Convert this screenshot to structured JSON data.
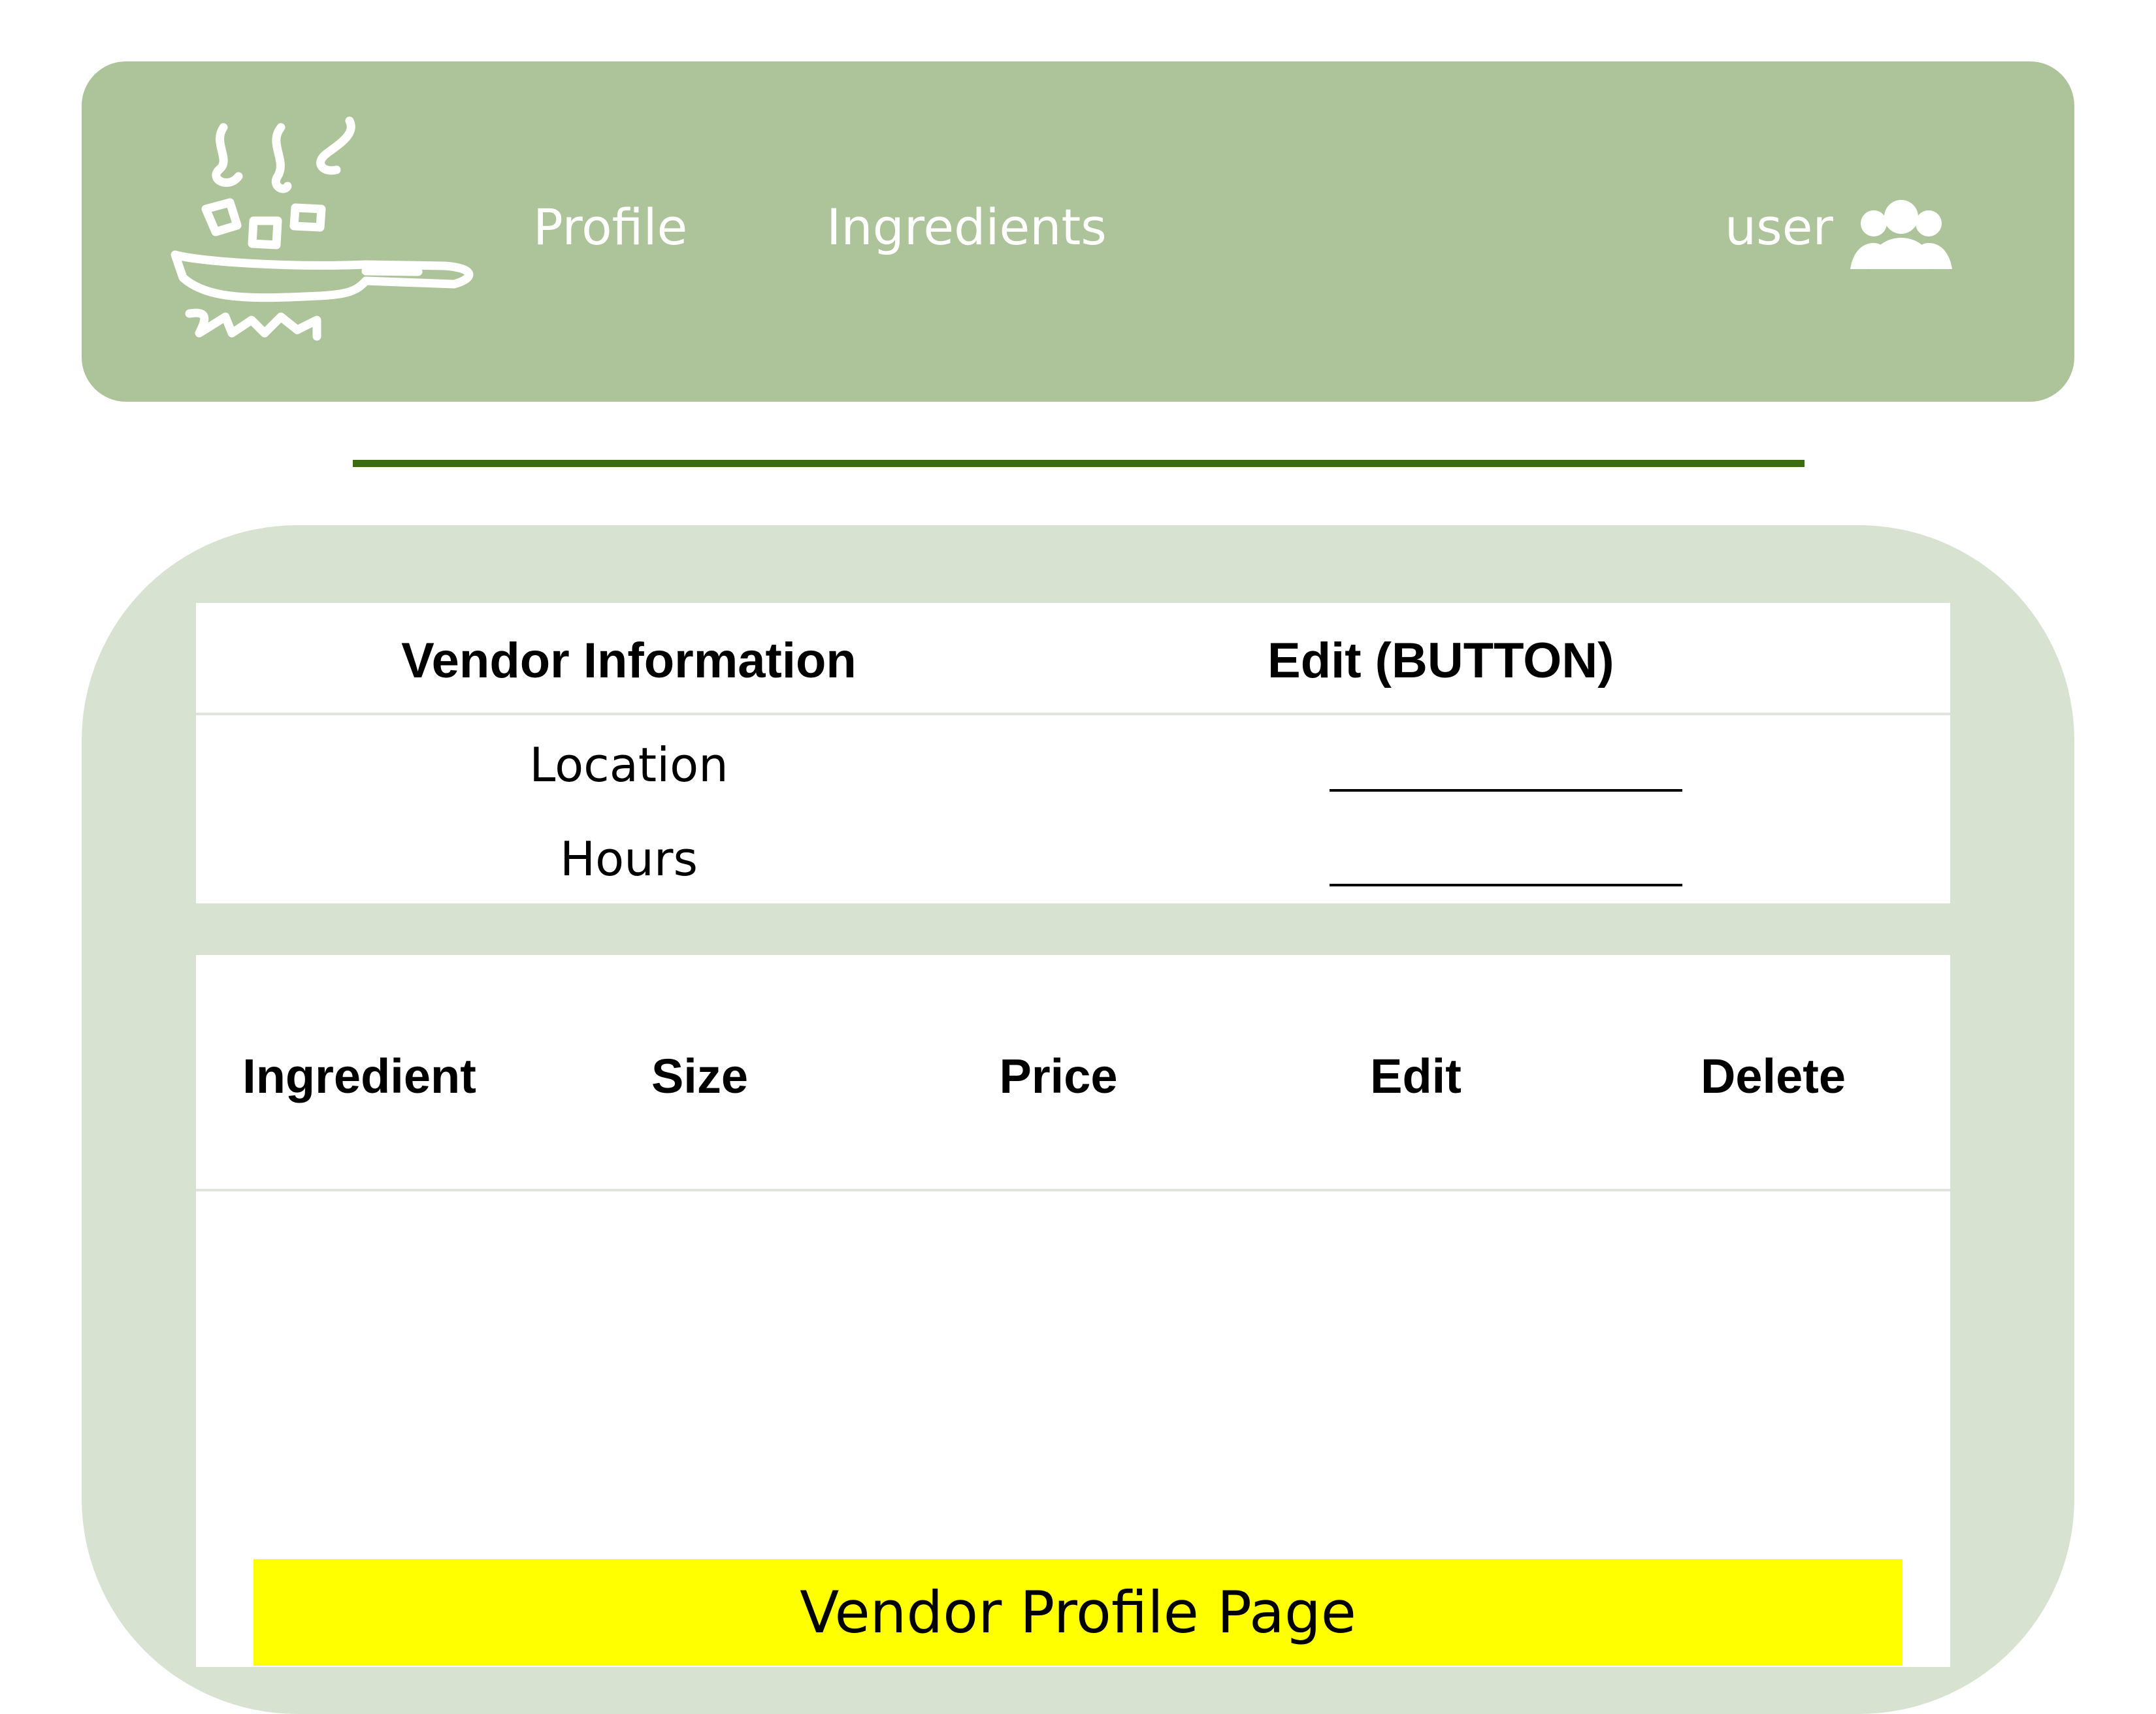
{
  "nav": {
    "logo_icon": "cooking-pan-icon",
    "profile": "Profile",
    "ingredients": "Ingredients",
    "user": "user",
    "user_icon": "users-icon"
  },
  "vendor_info": {
    "title": "Vendor Information",
    "edit": "Edit (BUTTON)",
    "rows": [
      {
        "label": "Location",
        "value": "______________"
      },
      {
        "label": "Hours",
        "value": "______________"
      }
    ]
  },
  "ingredients_table": {
    "columns": [
      "Ingredient",
      "Size",
      "Price",
      "Edit",
      "Delete"
    ],
    "rows": []
  },
  "page_label": "Vendor Profile Page",
  "colors": {
    "header": "#adc49a",
    "panel": "#d7e2d0",
    "divider": "#3d6b10",
    "highlight": "#ffff00"
  }
}
